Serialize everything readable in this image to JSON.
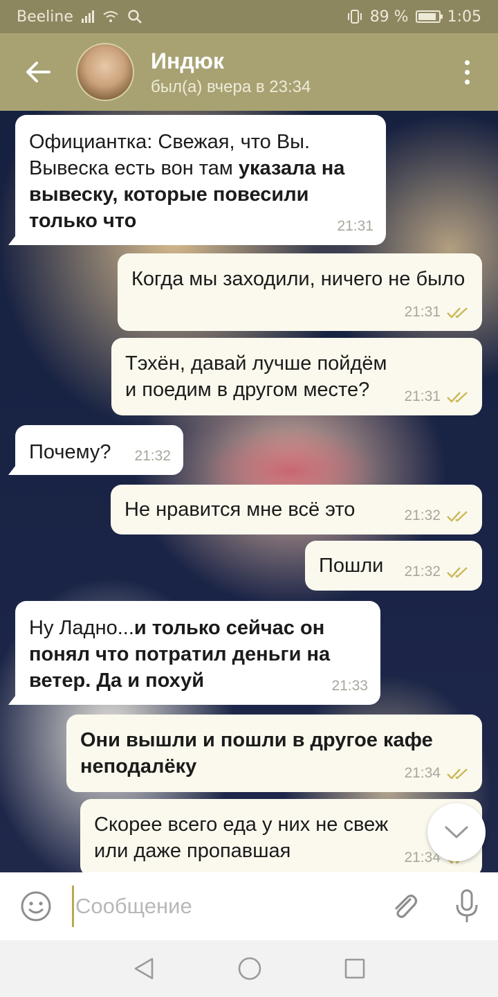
{
  "status_bar": {
    "carrier": "Beeline",
    "battery": "89 %",
    "battery_level": 0.89,
    "time": "1:05"
  },
  "header": {
    "contact_name": "Индюк",
    "contact_status": "был(а) вчера в 23:34",
    "back_icon": "arrow-left-icon",
    "menu_icon": "more-vertical-icon"
  },
  "messages": [
    {
      "direction": "in",
      "plain": "Официантка: Свежая, что Вы. Вывеска есть вон там ",
      "bold": "указала на вывеску, которые повесили только что",
      "time": "21:31"
    },
    {
      "direction": "out",
      "text": "Когда мы заходили, ничего не было",
      "time": "21:31",
      "read": true
    },
    {
      "direction": "out",
      "text": "Тэхён, давай лучше пойдём и поедим в другом месте?",
      "time": "21:31",
      "read": true
    },
    {
      "direction": "in",
      "text": "Почему?",
      "time": "21:32"
    },
    {
      "direction": "out",
      "text": "Не нравится мне всё это",
      "time": "21:32",
      "read": true
    },
    {
      "direction": "out",
      "text": "Пошли",
      "time": "21:32",
      "read": true
    },
    {
      "direction": "in",
      "plain": "Ну Ладно...",
      "bold": "и только сейчас он понял что потратил деньги на ветер. Да и похуй",
      "time": "21:33"
    },
    {
      "direction": "out",
      "bold": "Они вышли и пошли в другое кафе неподалёку",
      "time": "21:34",
      "read": true
    },
    {
      "direction": "out",
      "text": "Скорее всего еда у них не свеж или даже пропавшая",
      "time": "21:34",
      "read": true
    }
  ],
  "input": {
    "placeholder": "Сообщение",
    "value": ""
  },
  "icons": {
    "emoji": "smile-icon",
    "attach": "paperclip-icon",
    "mic": "microphone-icon",
    "scroll_down": "chevron-down-icon",
    "nav_back": "triangle-back-icon",
    "nav_home": "circle-home-icon",
    "nav_recents": "square-recents-icon"
  },
  "colors": {
    "header": "#a8a273",
    "status_bar": "#8d8760",
    "read_ticks": "#c9b958",
    "incoming_bubble": "#ffffff",
    "outgoing_bubble": "#fbf9ed"
  }
}
